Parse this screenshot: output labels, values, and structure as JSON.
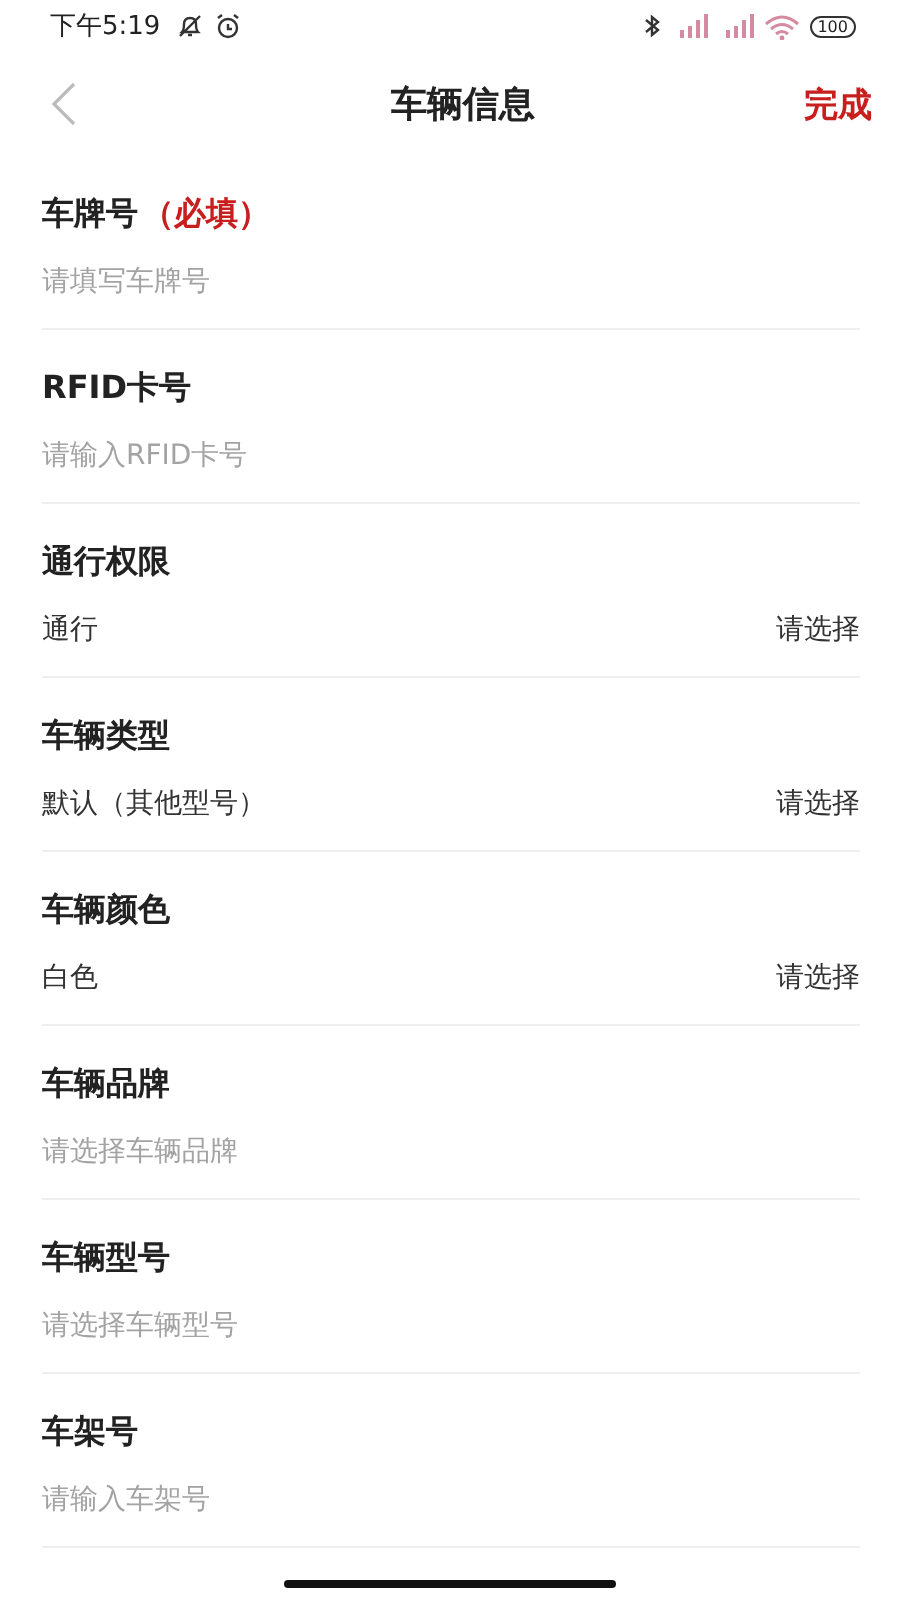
{
  "status_bar": {
    "time": "下午5:19",
    "battery": "100"
  },
  "nav": {
    "title": "车辆信息",
    "action": "完成"
  },
  "fields": [
    {
      "label": "车牌号",
      "note": "（必填）",
      "kind": "input",
      "placeholder": "请填写车牌号"
    },
    {
      "label": "RFID卡号",
      "kind": "input",
      "placeholder": "请输入RFID卡号"
    },
    {
      "label": "通行权限",
      "kind": "select",
      "value": "通行",
      "action": "请选择"
    },
    {
      "label": "车辆类型",
      "kind": "select",
      "value": "默认（其他型号）",
      "action": "请选择"
    },
    {
      "label": "车辆颜色",
      "kind": "select",
      "value": "白色",
      "action": "请选择"
    },
    {
      "label": "车辆品牌",
      "kind": "input",
      "placeholder": "请选择车辆品牌"
    },
    {
      "label": "车辆型号",
      "kind": "input",
      "placeholder": "请选择车辆型号"
    },
    {
      "label": "车架号",
      "kind": "input",
      "placeholder": "请输入车架号"
    }
  ]
}
